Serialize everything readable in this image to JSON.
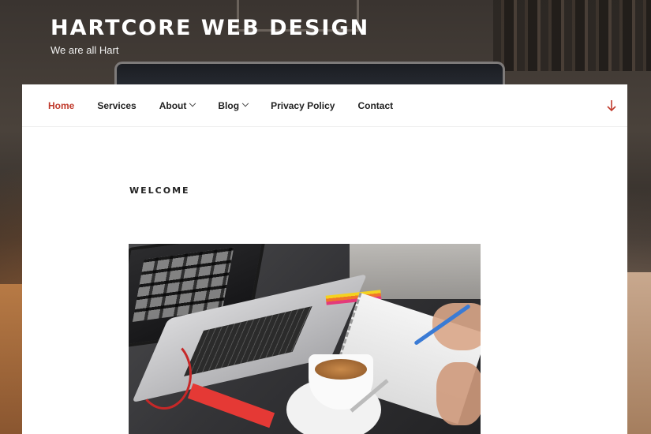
{
  "site": {
    "title": "HARTCORE WEB DESIGN",
    "description": "We are all Hart"
  },
  "nav": {
    "items": [
      {
        "label": "Home",
        "active": true,
        "has_submenu": false
      },
      {
        "label": "Services",
        "active": false,
        "has_submenu": false
      },
      {
        "label": "About",
        "active": false,
        "has_submenu": true
      },
      {
        "label": "Blog",
        "active": false,
        "has_submenu": true
      },
      {
        "label": "Privacy Policy",
        "active": false,
        "has_submenu": false
      },
      {
        "label": "Contact",
        "active": false,
        "has_submenu": false
      }
    ],
    "scroll_icon": "arrow-down-icon"
  },
  "page": {
    "title": "WELCOME"
  },
  "colors": {
    "accent": "#c0392b",
    "nav_text": "#222222",
    "panel_bg": "#ffffff"
  }
}
